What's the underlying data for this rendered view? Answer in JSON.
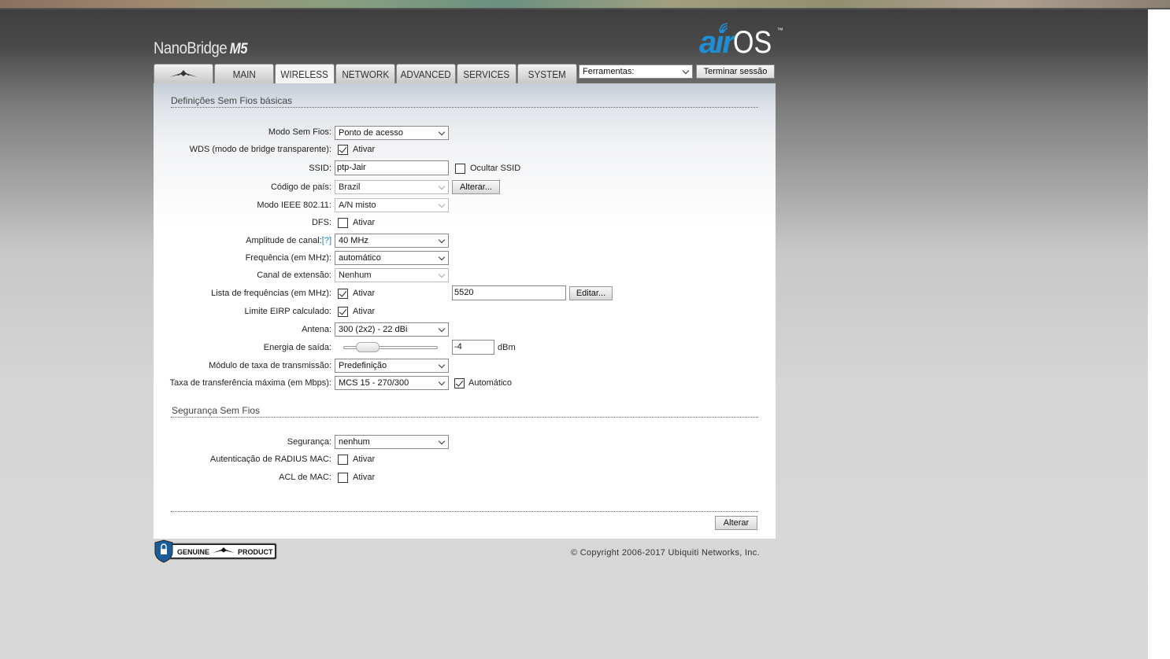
{
  "header": {
    "brand": "NanoBridge",
    "model": "M5",
    "logo_air": "air",
    "logo_os": "OS",
    "logo_tm": "™"
  },
  "tabs": [
    {
      "label": "",
      "icon": "ubiquiti-logo-icon"
    },
    {
      "label": "MAIN"
    },
    {
      "label": "WIRELESS",
      "active": true
    },
    {
      "label": "NETWORK"
    },
    {
      "label": "ADVANCED"
    },
    {
      "label": "SERVICES"
    },
    {
      "label": "SYSTEM"
    }
  ],
  "toolbar": {
    "tools_select": "Ferramentas:",
    "logout": "Terminar sessão"
  },
  "basic": {
    "title": "Definições Sem Fios básicas",
    "mode_label": "Modo Sem Fios:",
    "mode_value": "Ponto de acesso",
    "wds_label": "WDS (modo de bridge transparente):",
    "wds_enable": "Ativar",
    "wds_checked": true,
    "ssid_label": "SSID:",
    "ssid_value": "ptp-Jair",
    "hide_ssid": "Ocultar SSID",
    "hide_ssid_checked": false,
    "country_label": "Código de país:",
    "country_value": "Brazil",
    "country_change": "Alterar...",
    "ieee_label": "Modo IEEE 802.11:",
    "ieee_value": "A/N misto",
    "dfs_label": "DFS:",
    "dfs_enable": "Ativar",
    "dfs_checked": false,
    "width_label": "Amplitude de canal:",
    "width_help": "[?]",
    "width_value": "40 MHz",
    "freq_label": "Frequência (em MHz):",
    "freq_value": "automático",
    "ext_label": "Canal de extensão:",
    "ext_value": "Nenhum",
    "freqlist_label": "Lista de frequências (em MHz):",
    "freqlist_enable": "Ativar",
    "freqlist_checked": true,
    "freqlist_value": "5520",
    "freqlist_edit": "Editar...",
    "eirp_label": "Limite EIRP calculado:",
    "eirp_enable": "Ativar",
    "eirp_checked": true,
    "antenna_label": "Antena:",
    "antenna_value": "300 (2x2) - 22 dBi",
    "power_label": "Energia de saída:",
    "power_value": "-4",
    "power_unit": "dBm",
    "rate_module_label": "Módulo de taxa de transmissão:",
    "rate_module_value": "Predefinição",
    "max_rate_label": "Taxa de transferência máxima (em Mbps):",
    "max_rate_value": "MCS 15 - 270/300",
    "auto_label": "Automático",
    "auto_checked": true
  },
  "security": {
    "title": "Segurança Sem Fios",
    "security_label": "Segurança:",
    "security_value": "nenhum",
    "radius_label": "Autenticação de RADIUS MAC:",
    "radius_enable": "Ativar",
    "radius_checked": false,
    "acl_label": "ACL de MAC:",
    "acl_enable": "Ativar",
    "acl_checked": false
  },
  "footer": {
    "apply": "Alterar",
    "genuine_left": "GENUINE",
    "genuine_right": "PRODUCT",
    "copyright": "© Copyright 2006-2017 Ubiquiti Networks, Inc."
  },
  "colors": {
    "accent": "#1e8fd6",
    "help_link": "#1a7fc1"
  }
}
